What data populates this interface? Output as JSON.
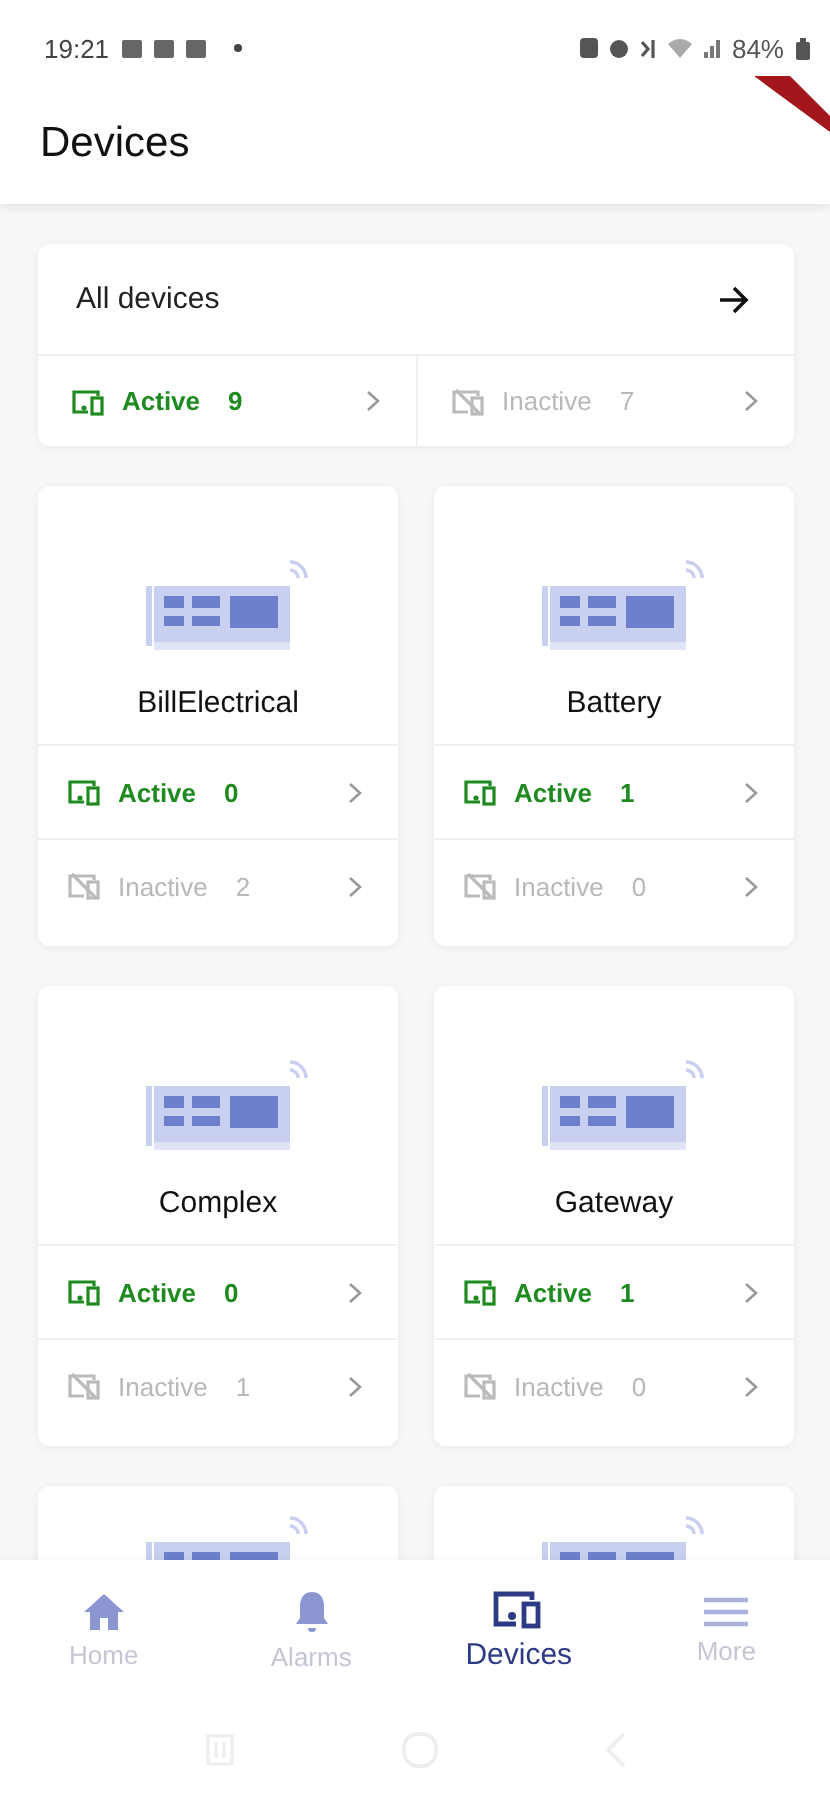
{
  "status_bar": {
    "time": "19:21",
    "battery": "84%"
  },
  "app_bar": {
    "title": "Devices",
    "debug_banner": true
  },
  "summary": {
    "title": "All devices",
    "active": {
      "label": "Active",
      "count": "9"
    },
    "inactive": {
      "label": "Inactive",
      "count": "7"
    }
  },
  "device_types": [
    {
      "kind": "full",
      "name": "BillElectrical",
      "active": {
        "label": "Active",
        "count": "0"
      },
      "inactive": {
        "label": "Inactive",
        "count": "2"
      }
    },
    {
      "kind": "full",
      "name": "Battery",
      "active": {
        "label": "Active",
        "count": "1"
      },
      "inactive": {
        "label": "Inactive",
        "count": "0"
      }
    },
    {
      "kind": "full",
      "name": "Complex",
      "active": {
        "label": "Active",
        "count": "0"
      },
      "inactive": {
        "label": "Inactive",
        "count": "1"
      }
    },
    {
      "kind": "full",
      "name": "Gateway",
      "active": {
        "label": "Active",
        "count": "1"
      },
      "inactive": {
        "label": "Inactive",
        "count": "0"
      }
    },
    {
      "kind": "partial"
    },
    {
      "kind": "partial"
    }
  ],
  "bottom_nav": [
    {
      "kind": "home",
      "label": "Home",
      "selected": false
    },
    {
      "kind": "alarms",
      "label": "Alarms",
      "selected": false
    },
    {
      "kind": "devices",
      "label": "Devices",
      "selected": true
    },
    {
      "kind": "more",
      "label": "More",
      "selected": false
    }
  ]
}
